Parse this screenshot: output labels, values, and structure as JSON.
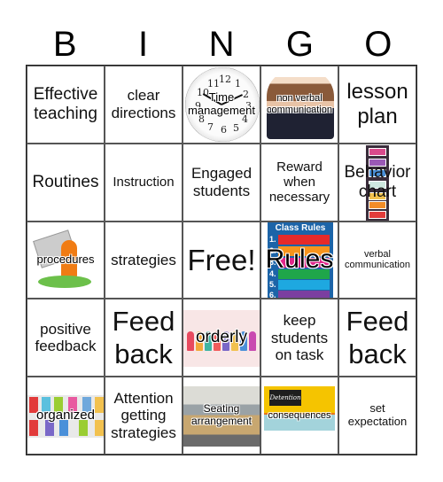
{
  "header": {
    "letters": [
      "B",
      "I",
      "N",
      "G",
      "O"
    ]
  },
  "cells": [
    {
      "text": "Effective teaching",
      "image": null
    },
    {
      "text": "clear directions",
      "image": null
    },
    {
      "text": "Time management",
      "image": "wall-clock"
    },
    {
      "text": "non verbal communication",
      "image": "woman-ok-gesture"
    },
    {
      "text": "lesson plan",
      "image": null
    },
    {
      "text": "Routines",
      "image": null
    },
    {
      "text": "Instruction",
      "image": null
    },
    {
      "text": "Engaged students",
      "image": null
    },
    {
      "text": "Reward when necessary",
      "image": null
    },
    {
      "text": "Behavior chart",
      "image": "behavior-clip-chart"
    },
    {
      "text": "procedures",
      "image": "procedure-reader"
    },
    {
      "text": "strategies",
      "image": null
    },
    {
      "text": "Free!",
      "image": null
    },
    {
      "text": "Rules",
      "image": "class-rules-poster"
    },
    {
      "text": "verbal communication",
      "image": null
    },
    {
      "text": "positive feedback",
      "image": null
    },
    {
      "text": "Feed back",
      "image": null
    },
    {
      "text": "orderly",
      "image": "kids-in-line"
    },
    {
      "text": "keep students on task",
      "image": null
    },
    {
      "text": "Feed back",
      "image": null
    },
    {
      "text": "organized",
      "image": "organized-shelves"
    },
    {
      "text": "Attention getting strategies",
      "image": null
    },
    {
      "text": "Seating arrangement",
      "image": "classroom-photo"
    },
    {
      "text": "consequences",
      "image": "detention-room"
    },
    {
      "text": "set expectation",
      "image": null
    }
  ],
  "art": {
    "clock_numbers": [
      "12",
      "1",
      "2",
      "3",
      "4",
      "5",
      "6",
      "7",
      "8",
      "9",
      "10",
      "11"
    ],
    "rules_poster_title": "Class Rules",
    "rules_poster_numbers": [
      "1.",
      "2.",
      "3.",
      "4.",
      "5.",
      "6."
    ],
    "rules_colors": [
      "#e62a2a",
      "#f7941d",
      "#e0278a",
      "#1fa64a",
      "#1ea8e0",
      "#7b3fa0"
    ],
    "detention_board_text": "Detention"
  }
}
